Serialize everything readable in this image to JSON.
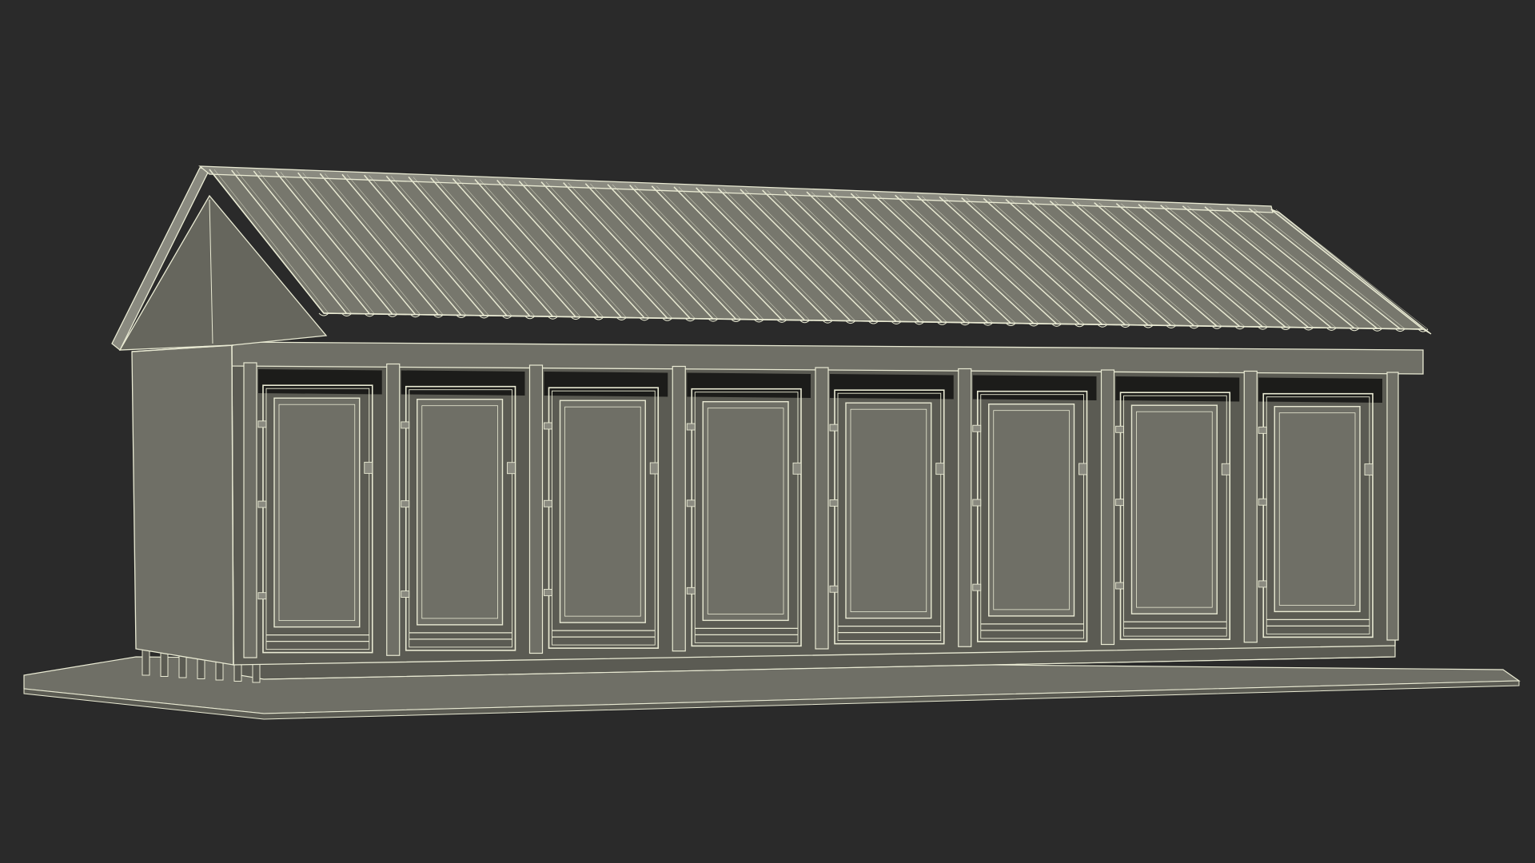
{
  "scene": {
    "subject": "toilet-block-wireframe-model",
    "stall_count": 8,
    "roof_rib_count": 48,
    "colors": {
      "background": "#2a2a2a",
      "surface": "#6f6f66",
      "surface_dark": "#5b5b53",
      "surface_light": "#8a8a80",
      "wire": "#e9ead3",
      "shadow": "#1c1c1a"
    },
    "icons": {
      "model": "building-model-icon"
    }
  }
}
